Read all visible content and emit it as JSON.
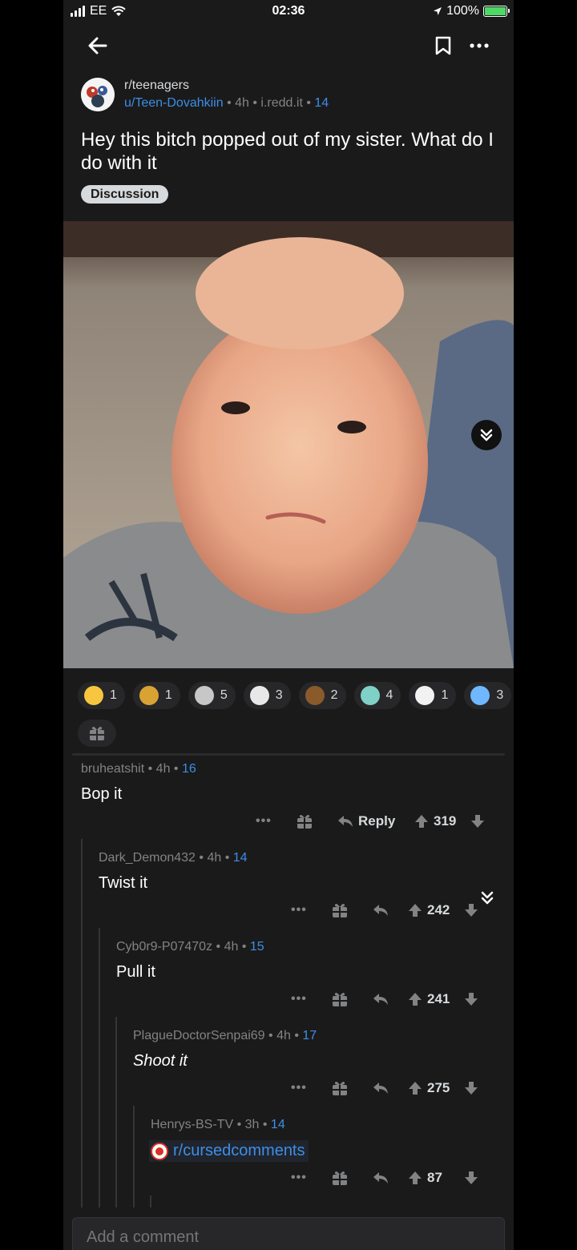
{
  "status_bar": {
    "carrier": "EE",
    "time": "02:36",
    "battery": "100%",
    "battery_level": 1.0
  },
  "post": {
    "subreddit": "r/teenagers",
    "author": "u/Teen-Dovahkiin",
    "age": "4h",
    "domain": "i.redd.it",
    "author_flair_num": "14",
    "title": "Hey this bitch popped out of my sister. What do I do with it",
    "flair": "Discussion"
  },
  "awards": [
    {
      "icon": "gold-award-icon",
      "count": "1",
      "color": "#f6c63f"
    },
    {
      "icon": "lion-award-icon",
      "count": "1",
      "color": "#d8a333"
    },
    {
      "icon": "clap-award-icon",
      "count": "5",
      "color": "#c7c7c7"
    },
    {
      "icon": "bubble-award-icon",
      "count": "3",
      "color": "#e8e8e8"
    },
    {
      "icon": "poop-award-icon",
      "count": "2",
      "color": "#8a5a2b"
    },
    {
      "icon": "angel-award-icon",
      "count": "4",
      "color": "#7fd1c8"
    },
    {
      "icon": "snoo-award-icon",
      "count": "1",
      "color": "#f2f2f2"
    },
    {
      "icon": "cry-award-icon",
      "count": "3",
      "color": "#6fb7ff"
    }
  ],
  "comments": [
    {
      "author": "bruheatshit",
      "age": "4h",
      "flair": "16",
      "body": "Bop it",
      "score": "319",
      "reply_label": "Reply"
    },
    {
      "author": "Dark_Demon432",
      "age": "4h",
      "flair": "14",
      "body": "Twist it",
      "score": "242"
    },
    {
      "author": "Cyb0r9-P07470z",
      "age": "4h",
      "flair": "15",
      "body": "Pull it",
      "score": "241"
    },
    {
      "author": "PlagueDoctorSenpai69",
      "age": "4h",
      "flair": "17",
      "body": "Shoot it",
      "score": "275"
    },
    {
      "author": "Henrys-BS-TV",
      "age": "3h",
      "flair": "14",
      "body": "r/cursedcomments",
      "score": "87"
    }
  ],
  "comment_input": {
    "placeholder": "Add a comment"
  }
}
